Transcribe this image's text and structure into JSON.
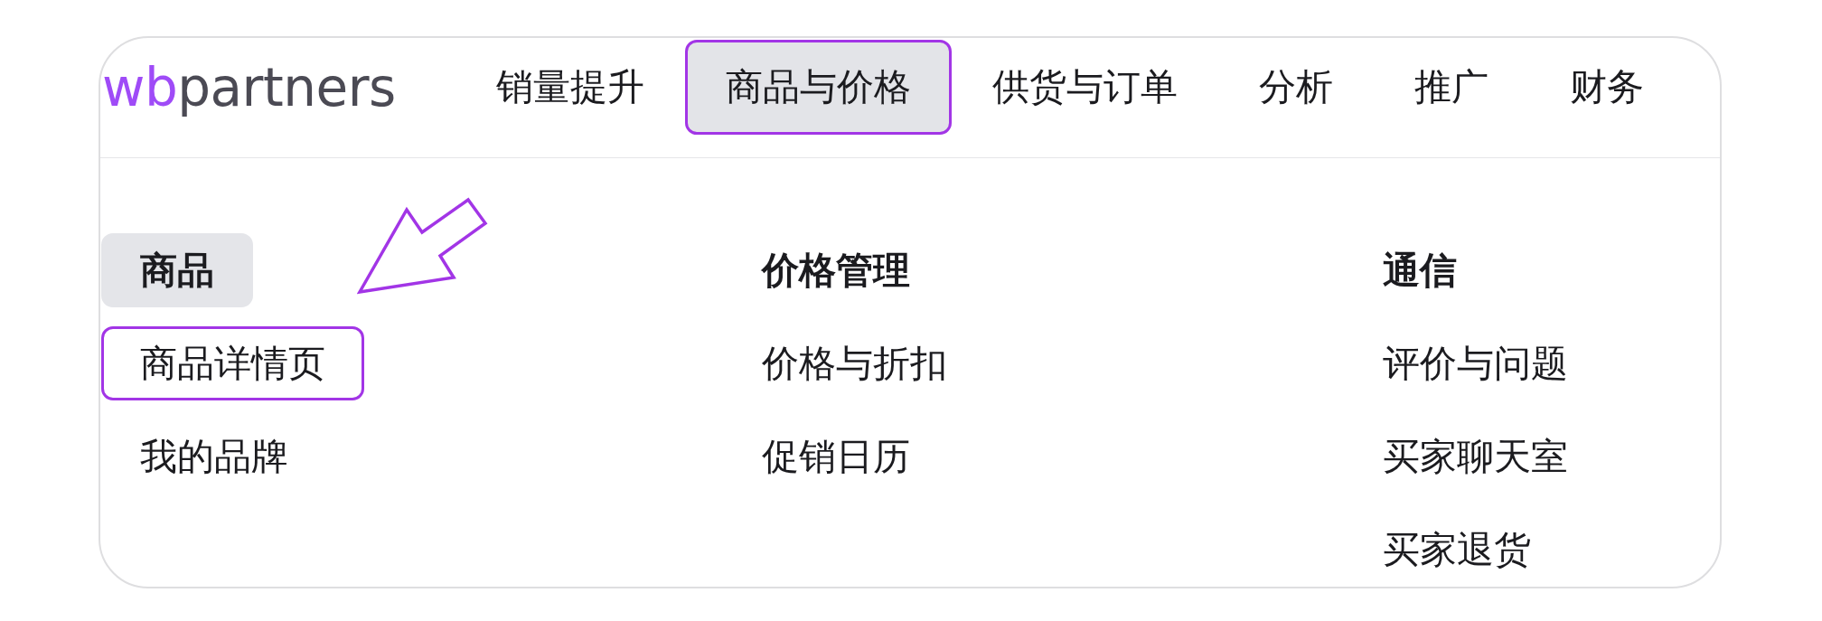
{
  "logo": {
    "accent": "wb",
    "text": "partners"
  },
  "nav": [
    {
      "label": "销量提升",
      "selected": false,
      "highlighted": false
    },
    {
      "label": "商品与价格",
      "selected": true,
      "highlighted": true
    },
    {
      "label": "供货与订单",
      "selected": false,
      "highlighted": false
    },
    {
      "label": "分析",
      "selected": false,
      "highlighted": false
    },
    {
      "label": "推广",
      "selected": false,
      "highlighted": false
    },
    {
      "label": "财务",
      "selected": false,
      "highlighted": false
    }
  ],
  "menu": {
    "columns": [
      {
        "header": {
          "label": "商品",
          "selected": true
        },
        "items": [
          {
            "label": "商品详情页",
            "highlighted": true
          },
          {
            "label": "我的品牌",
            "highlighted": false
          }
        ]
      },
      {
        "header": {
          "label": "价格管理",
          "selected": false
        },
        "items": [
          {
            "label": "价格与折扣",
            "highlighted": false
          },
          {
            "label": "促销日历",
            "highlighted": false
          }
        ]
      },
      {
        "header": {
          "label": "通信",
          "selected": false
        },
        "items": [
          {
            "label": "评价与问题",
            "highlighted": false
          },
          {
            "label": "买家聊天室",
            "highlighted": false
          },
          {
            "label": "买家退货",
            "highlighted": false
          }
        ]
      }
    ]
  },
  "annotations": [
    {
      "kind": "arrow"
    }
  ]
}
